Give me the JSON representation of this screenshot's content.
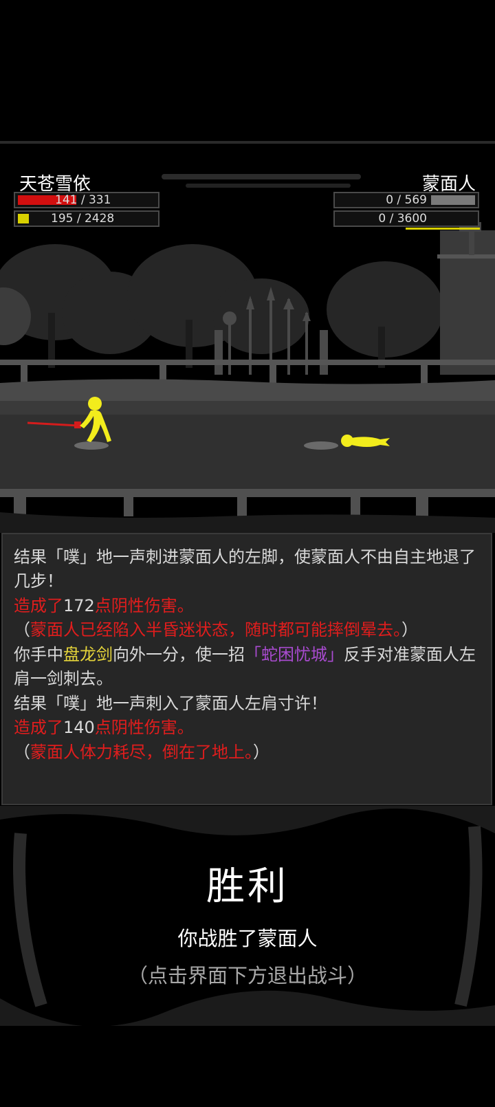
{
  "player": {
    "name": "天苍雪依",
    "hp_text": "141 / 331",
    "mp_text": "195 / 2428",
    "hp_fraction": 0.426,
    "mp_fraction": 0.08
  },
  "enemy": {
    "name": "蒙面人",
    "hp_text": "0 / 569",
    "mp_text": "0 / 3600",
    "hp_fraction": 0.0,
    "mp_fraction": 0.0
  },
  "log": {
    "lines": [
      {
        "segments": [
          {
            "text": "结果「噗」地一声刺进蒙面人的左脚，使蒙面人不由自主地退了几步！",
            "color": "default"
          }
        ]
      },
      {
        "segments": [
          {
            "text": "造成了",
            "color": "red"
          },
          {
            "text": "172",
            "color": "default"
          },
          {
            "text": "点阴性伤害。",
            "color": "red"
          }
        ]
      },
      {
        "segments": [
          {
            "text": "（",
            "color": "default"
          },
          {
            "text": "蒙面人已经陷入半昏迷状态，随时都可能摔倒晕去。",
            "color": "red"
          },
          {
            "text": "）",
            "color": "default"
          }
        ]
      },
      {
        "segments": [
          {
            "text": "你手中",
            "color": "default"
          },
          {
            "text": "盘龙剑",
            "color": "yellow"
          },
          {
            "text": "向外一分，使一招",
            "color": "default"
          },
          {
            "text": "「蛇困忧城」",
            "color": "purple"
          },
          {
            "text": "反手对准蒙面人左肩一剑刺去。",
            "color": "default"
          }
        ]
      },
      {
        "segments": [
          {
            "text": "结果「噗」地一声刺入了蒙面人左肩寸许！",
            "color": "default"
          }
        ]
      },
      {
        "segments": [
          {
            "text": "造成了",
            "color": "red"
          },
          {
            "text": "140",
            "color": "default"
          },
          {
            "text": "点阴性伤害。",
            "color": "red"
          }
        ]
      },
      {
        "segments": [
          {
            "text": "（",
            "color": "default"
          },
          {
            "text": "蒙面人体力耗尽，倒在了地上。",
            "color": "red"
          },
          {
            "text": "）",
            "color": "default"
          }
        ]
      }
    ]
  },
  "result": {
    "title": "胜利",
    "subtitle": "你战胜了蒙面人",
    "hint": "（点击界面下方退出战斗）"
  },
  "colors": {
    "hp": "#d20f0f",
    "mp": "#d8d000",
    "hero": "#f2ec1c",
    "sword": "#d41c1c",
    "log_red": "#e11d1d",
    "log_yellow": "#e5d43a",
    "log_purple": "#a94bd0"
  }
}
